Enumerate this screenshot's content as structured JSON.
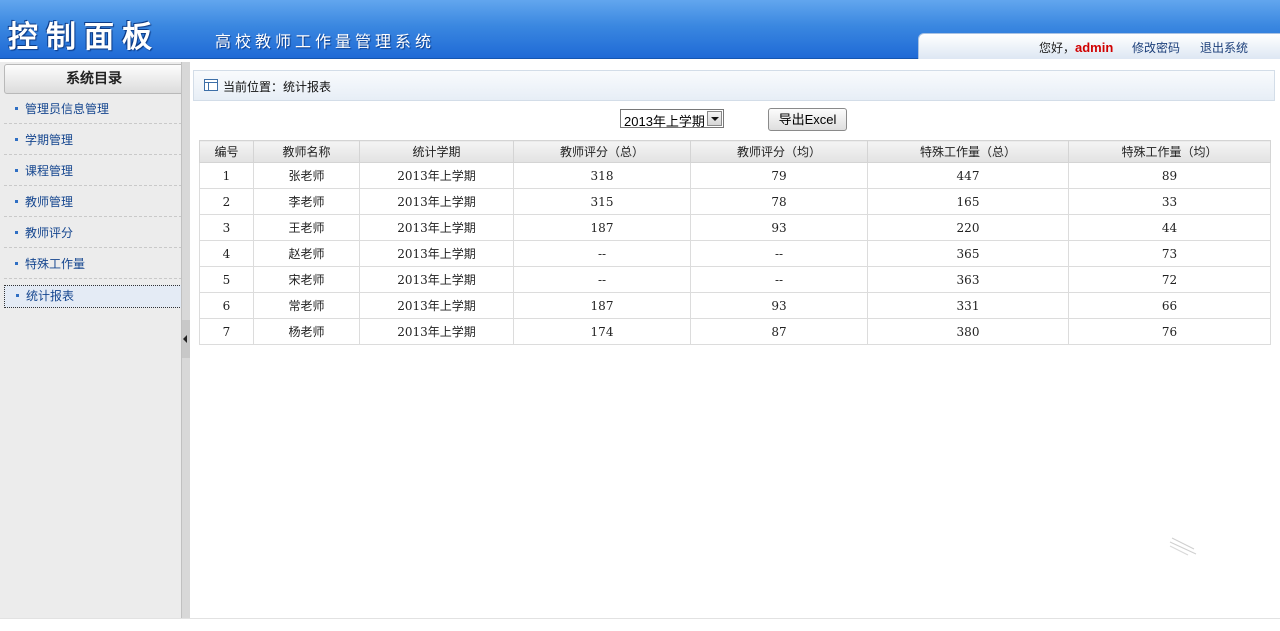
{
  "header": {
    "brand": "控制面板",
    "system_title": "高校教师工作量管理系统",
    "greeting": "您好，",
    "username": "admin",
    "change_password": "修改密码",
    "logout": "退出系统"
  },
  "sidebar": {
    "title": "系统目录",
    "items": [
      {
        "label": "管理员信息管理"
      },
      {
        "label": "学期管理"
      },
      {
        "label": "课程管理"
      },
      {
        "label": "教师管理"
      },
      {
        "label": "教师评分"
      },
      {
        "label": "特殊工作量"
      },
      {
        "label": "统计报表",
        "active": true
      }
    ]
  },
  "breadcrumb": {
    "text": "当前位置：统计报表"
  },
  "toolbar": {
    "semester_selected": "2013年上学期",
    "export_label": "导出Excel"
  },
  "table": {
    "headers": [
      "编号",
      "教师名称",
      "统计学期",
      "教师评分（总）",
      "教师评分（均）",
      "特殊工作量（总）",
      "特殊工作量（均）"
    ],
    "rows": [
      [
        "1",
        "张老师",
        "2013年上学期",
        "318",
        "79",
        "447",
        "89"
      ],
      [
        "2",
        "李老师",
        "2013年上学期",
        "315",
        "78",
        "165",
        "33"
      ],
      [
        "3",
        "王老师",
        "2013年上学期",
        "187",
        "93",
        "220",
        "44"
      ],
      [
        "4",
        "赵老师",
        "2013年上学期",
        "--",
        "--",
        "365",
        "73"
      ],
      [
        "5",
        "宋老师",
        "2013年上学期",
        "--",
        "--",
        "363",
        "72"
      ],
      [
        "6",
        "常老师",
        "2013年上学期",
        "187",
        "93",
        "331",
        "66"
      ],
      [
        "7",
        "杨老师",
        "2013年上学期",
        "174",
        "87",
        "380",
        "76"
      ]
    ]
  },
  "colors": {
    "header_blue": "#3a87e0",
    "username_red": "#d00000",
    "link_blue": "#15468f"
  },
  "icons": [
    "breadcrumb-panel-icon",
    "dropdown-arrow-icon",
    "collapse-arrow-icon"
  ]
}
